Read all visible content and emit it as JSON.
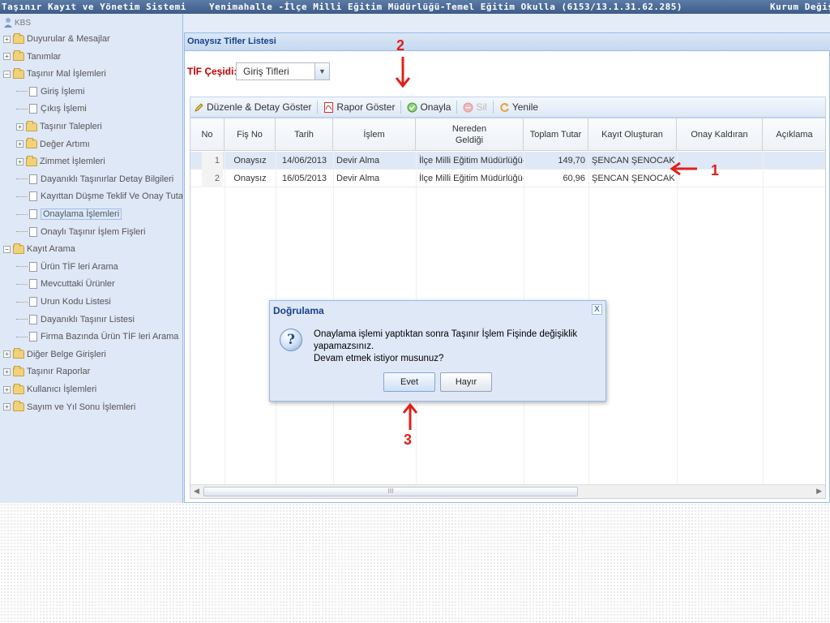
{
  "titlebar": {
    "app_title": "Taşınır Kayıt ve Yönetim Sistemi",
    "institution": "Yenimahalle -İlçe Milli Eğitim Müdürlüğü-Temel Eğitim Okulla (6153/13.1.31.62.285)",
    "right_link": "Kurum Değişt"
  },
  "sidebar": {
    "root": "KBS",
    "items": [
      {
        "label": "Duyurular & Mesajlar",
        "type": "folder",
        "state": "collapsed"
      },
      {
        "label": "Tanımlar",
        "type": "folder",
        "state": "collapsed"
      },
      {
        "label": "Taşınır Mal İşlemleri",
        "type": "folder",
        "state": "expanded"
      },
      {
        "label": "Giriş İşlemi",
        "type": "doc"
      },
      {
        "label": "Çıkış İşlemi",
        "type": "doc"
      },
      {
        "label": "Taşınır Talepleri",
        "type": "folder",
        "state": "collapsed"
      },
      {
        "label": "Değer Artımı",
        "type": "folder",
        "state": "collapsed"
      },
      {
        "label": "Zimmet İşlemleri",
        "type": "folder",
        "state": "collapsed"
      },
      {
        "label": "Dayanıklı Taşınırlar Detay Bilgileri",
        "type": "doc"
      },
      {
        "label": "Kayıttan Düşme Teklif Ve Onay Tutanağı",
        "type": "doc"
      },
      {
        "label": "Onaylama İşlemleri",
        "type": "doc",
        "selected": true
      },
      {
        "label": "Onaylı Taşınır İşlem Fişleri",
        "type": "doc"
      },
      {
        "label": "Kayıt Arama",
        "type": "folder",
        "state": "expanded"
      },
      {
        "label": "Ürün TİF leri Arama",
        "type": "doc"
      },
      {
        "label": "Mevcuttaki Ürünler",
        "type": "doc"
      },
      {
        "label": "Urun Kodu Listesi",
        "type": "doc"
      },
      {
        "label": "Dayanıklı Taşınır Listesi",
        "type": "doc"
      },
      {
        "label": "Firma Bazında Ürün TİF leri Arama",
        "type": "doc"
      },
      {
        "label": "Diğer Belge Girişleri",
        "type": "folder",
        "state": "collapsed"
      },
      {
        "label": "Taşınır Raporlar",
        "type": "folder",
        "state": "collapsed"
      },
      {
        "label": "Kullanıcı İşlemleri",
        "type": "folder",
        "state": "collapsed"
      },
      {
        "label": "Sayım ve Yıl Sonu İşlemleri",
        "type": "folder",
        "state": "collapsed"
      }
    ]
  },
  "panel": {
    "title": "Onaysız Tifler Listesi",
    "tif_label": "TİF Çeşidi:",
    "tif_value": "Giriş Tifleri"
  },
  "toolbar": {
    "edit": "Düzenle & Detay Göster",
    "report": "Rapor Göster",
    "approve": "Onayla",
    "delete": "Sil",
    "refresh": "Yenile"
  },
  "grid": {
    "columns": [
      "No",
      "Fiş No",
      "Tarih",
      "İşlem",
      "Nereden Geldiği",
      "Toplam Tutar",
      "Kayıt Oluşturan",
      "Onay Kaldıran",
      "Açıklama"
    ],
    "rows": [
      {
        "rn": "1",
        "no": "",
        "fis_no": "Onaysız",
        "tarih": "14/06/2013",
        "islem": "Devir Alma",
        "nereden": "İlçe Milli Eğitim Müdürlüğü-",
        "tutar": "149,70",
        "olusturan": "ŞENCAN ŞENOCAK",
        "kaldiran": "",
        "aciklama": ""
      },
      {
        "rn": "2",
        "no": "",
        "fis_no": "Onaysız",
        "tarih": "16/05/2013",
        "islem": "Devir Alma",
        "nereden": "İlçe Milli Eğitim Müdürlüğü-",
        "tutar": "60,96",
        "olusturan": "ŞENCAN ŞENOCAK",
        "kaldiran": "",
        "aciklama": ""
      }
    ],
    "scroll_thumb": "III"
  },
  "dialog": {
    "title": "Doğrulama",
    "icon": "?",
    "close": "X",
    "message_line1": "Onaylama işlemi yaptıktan sonra Taşınır İşlem Fişinde değişiklik yapamazsınız.",
    "message_line2": "Devam etmek istiyor musunuz?",
    "yes": "Evet",
    "no": "Hayır"
  },
  "annotations": {
    "n1": "1",
    "n2": "2",
    "n3": "3",
    "color": "#e0201a"
  }
}
